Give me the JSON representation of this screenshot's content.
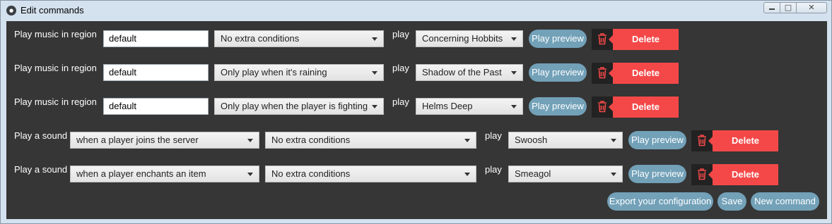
{
  "window": {
    "title": "Edit commands",
    "app_icon": "app-icon"
  },
  "commands": [
    {
      "kind": "music",
      "label": "Play music",
      "region_label": "in region",
      "region": "default",
      "condition": "No extra conditions",
      "play_label": "play",
      "target": "Concerning Hobbits",
      "preview_label": "Play preview",
      "delete_label": "Delete"
    },
    {
      "kind": "music",
      "label": "Play music",
      "region_label": "in region",
      "region": "default",
      "condition": "Only play when it's raining",
      "play_label": "play",
      "target": "Shadow of the Past",
      "preview_label": "Play preview",
      "delete_label": "Delete"
    },
    {
      "kind": "music",
      "label": "Play music",
      "region_label": "in region",
      "region": "default",
      "condition": "Only play when the player is fighting",
      "play_label": "play",
      "target": "Helms Deep",
      "preview_label": "Play preview",
      "delete_label": "Delete"
    },
    {
      "kind": "sound",
      "label": "Play a sound",
      "event": "when a player joins the server",
      "condition": "No extra conditions",
      "play_label": "play",
      "target": "Swoosh",
      "preview_label": "Play preview",
      "delete_label": "Delete"
    },
    {
      "kind": "sound",
      "label": "Play a sound",
      "event": "when a player enchants an item",
      "condition": "No extra conditions",
      "play_label": "play",
      "target": "Smeagol",
      "preview_label": "Play preview",
      "delete_label": "Delete"
    }
  ],
  "footer": {
    "export_label": "Export your configuration",
    "save_label": "Save",
    "new_label": "New command"
  },
  "colors": {
    "panel": "#363636",
    "accent": "#72a1b8",
    "danger": "#f44848"
  }
}
